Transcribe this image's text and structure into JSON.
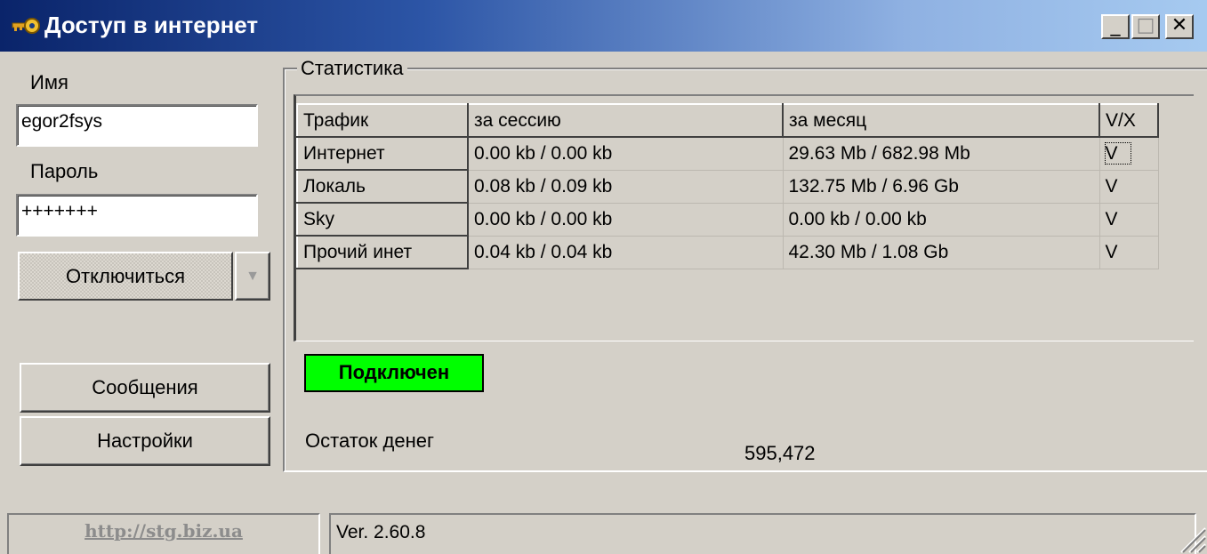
{
  "window": {
    "title": "Доступ в интернет",
    "controls": {
      "minimize": "_",
      "maximize": "□",
      "close": "✕"
    }
  },
  "sidebar": {
    "name_label": "Имя",
    "name_value": "egor2fsys",
    "password_label": "Пароль",
    "password_value": "+++++++",
    "disconnect_button": "Отключиться",
    "messages_button": "Сообщения",
    "settings_button": "Настройки"
  },
  "stats": {
    "group_title": "Статистика",
    "columns": [
      "Трафик",
      "за сессию",
      "за месяц",
      "V/X"
    ],
    "rows": [
      {
        "name": "Интернет",
        "session": "0.00 kb / 0.00 kb",
        "month": "29.63 Mb / 682.98 Mb",
        "flag": "V"
      },
      {
        "name": "Локаль",
        "session": "0.08 kb / 0.09 kb",
        "month": "132.75 Mb / 6.96 Gb",
        "flag": "V"
      },
      {
        "name": "Sky",
        "session": "0.00 kb / 0.00 kb",
        "month": "0.00 kb / 0.00 kb",
        "flag": "V"
      },
      {
        "name": "Прочий инет",
        "session": "0.04 kb / 0.04 kb",
        "month": "42.30 Mb / 1.08 Gb",
        "flag": "V"
      }
    ],
    "status": "Подключен",
    "status_color": "#00ff00",
    "balance_label": "Остаток денег",
    "balance_value": "595,472"
  },
  "statusbar": {
    "link": "http://stg.biz.ua",
    "version": "Ver. 2.60.8"
  },
  "icons": {
    "app": "key-icon",
    "grip": "size-grip-icon",
    "dropdown": "chevron-down-icon"
  }
}
